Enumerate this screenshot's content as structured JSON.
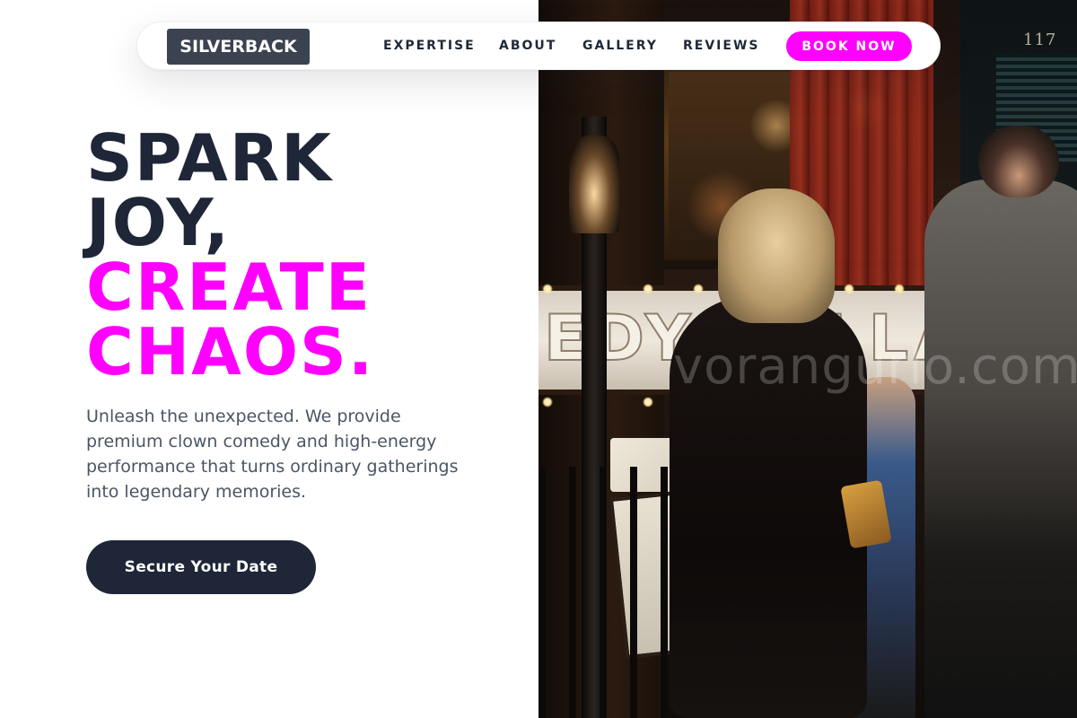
{
  "brand": {
    "logo_text": "SILVERBACK"
  },
  "nav": {
    "links": [
      "EXPERTISE",
      "ABOUT",
      "GALLERY",
      "REVIEWS"
    ],
    "cta_label": "BOOK NOW"
  },
  "hero": {
    "headline_lines": [
      "SPARK",
      "JOY,",
      "CREATE",
      "CHAOS."
    ],
    "description": "Unleash the unexpected. We provide premium clown comedy and high-energy performance that turns ordinary gatherings into legendary memories.",
    "cta_label": "Secure Your Date"
  },
  "photo": {
    "sign_text": "EDY CELLAR",
    "door_number": "117",
    "watermark": "vorangurlo.com"
  },
  "colors": {
    "accent": "#ff00ff",
    "dark": "#1e2638",
    "logo_bg": "#3b4250",
    "body_text": "#4b5565"
  }
}
